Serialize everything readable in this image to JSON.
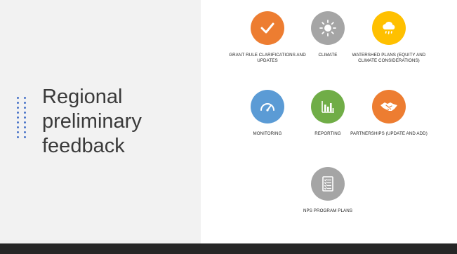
{
  "slide": {
    "title": "Regional preliminary feedback"
  },
  "colors": {
    "orange": "#ed7d31",
    "gray": "#a5a5a5",
    "yellow": "#ffc000",
    "blue": "#5b9bd5",
    "green": "#70ad47",
    "footer": "#262626",
    "left_panel": "#f2f2f2",
    "accent_dots": "#4a74c9"
  },
  "items": [
    {
      "label": "GRANT RULE CLARIFICATIONS AND UPDATES",
      "icon": "checkmark-icon",
      "color": "#ed7d31"
    },
    {
      "label": "CLIMATE",
      "icon": "sun-icon",
      "color": "#a5a5a5"
    },
    {
      "label": "WATERSHED PLANS (EQUITY AND CLIMATE CONSIDERATIONS)",
      "icon": "rain-cloud-icon",
      "color": "#ffc000"
    },
    {
      "label": "MONITORING",
      "icon": "gauge-icon",
      "color": "#5b9bd5"
    },
    {
      "label": "REPORTING",
      "icon": "bar-chart-icon",
      "color": "#70ad47"
    },
    {
      "label": "PARTNERSHIPS (UPDATE AND ADD)",
      "icon": "handshake-icon",
      "color": "#ed7d31"
    },
    {
      "label": "NPS PROGRAM PLANS",
      "icon": "checklist-icon",
      "color": "#a5a5a5"
    }
  ]
}
